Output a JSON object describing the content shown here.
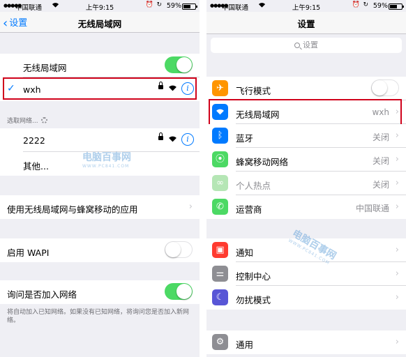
{
  "status_bar": {
    "carrier": "中国联通",
    "time": "上午9:15",
    "battery": "59%"
  },
  "left": {
    "nav": {
      "back_label": "设置",
      "title": "无线局域网"
    },
    "wifi_toggle": {
      "label": "无线局域网",
      "on": true
    },
    "connected_network": {
      "name": "wxh"
    },
    "choose_network_header": "选取网络...",
    "networks": [
      {
        "name": "2222"
      }
    ],
    "other_label": "其他...",
    "apps_row_label": "使用无线局域网与蜂窝移动的应用",
    "wapi": {
      "label": "启用 WAPI",
      "on": false
    },
    "ask_join": {
      "label": "询问是否加入网络",
      "on": true
    },
    "ask_join_footnote": "将自动加入已知网络。如果没有已知网络，将询问您是否加入新网络。"
  },
  "right": {
    "nav": {
      "title": "设置"
    },
    "search_placeholder": "设置",
    "rows": [
      {
        "label": "飞行模式",
        "icon": "airplane-icon",
        "color": "#ff9500",
        "toggle": false
      },
      {
        "label": "无线局域网",
        "icon": "wifi-icon",
        "color": "#007aff",
        "value": "wxh"
      },
      {
        "label": "蓝牙",
        "icon": "bluetooth-icon",
        "color": "#007aff",
        "value": "关闭"
      },
      {
        "label": "蜂窝移动网络",
        "icon": "cellular-icon",
        "color": "#4cd964",
        "value": "关闭"
      },
      {
        "label": "个人热点",
        "icon": "hotspot-icon",
        "color": "#b5e6b5",
        "value": "关闭",
        "disabled": true
      },
      {
        "label": "运营商",
        "icon": "phone-icon",
        "color": "#4cd964",
        "value": "中国联通"
      },
      {
        "label": "通知",
        "icon": "notifications-icon",
        "color": "#ff3b30"
      },
      {
        "label": "控制中心",
        "icon": "control-center-icon",
        "color": "#8e8e93"
      },
      {
        "label": "勿扰模式",
        "icon": "moon-icon",
        "color": "#5856d6"
      },
      {
        "label": "通用",
        "icon": "gear-icon",
        "color": "#8e8e93"
      }
    ]
  },
  "watermark": {
    "text": "电脑百事网",
    "sub": "WWW.PC841.COM"
  },
  "colors": {
    "accent": "#007aff",
    "toggle_on": "#4cd964",
    "highlight": "#d0021b"
  }
}
